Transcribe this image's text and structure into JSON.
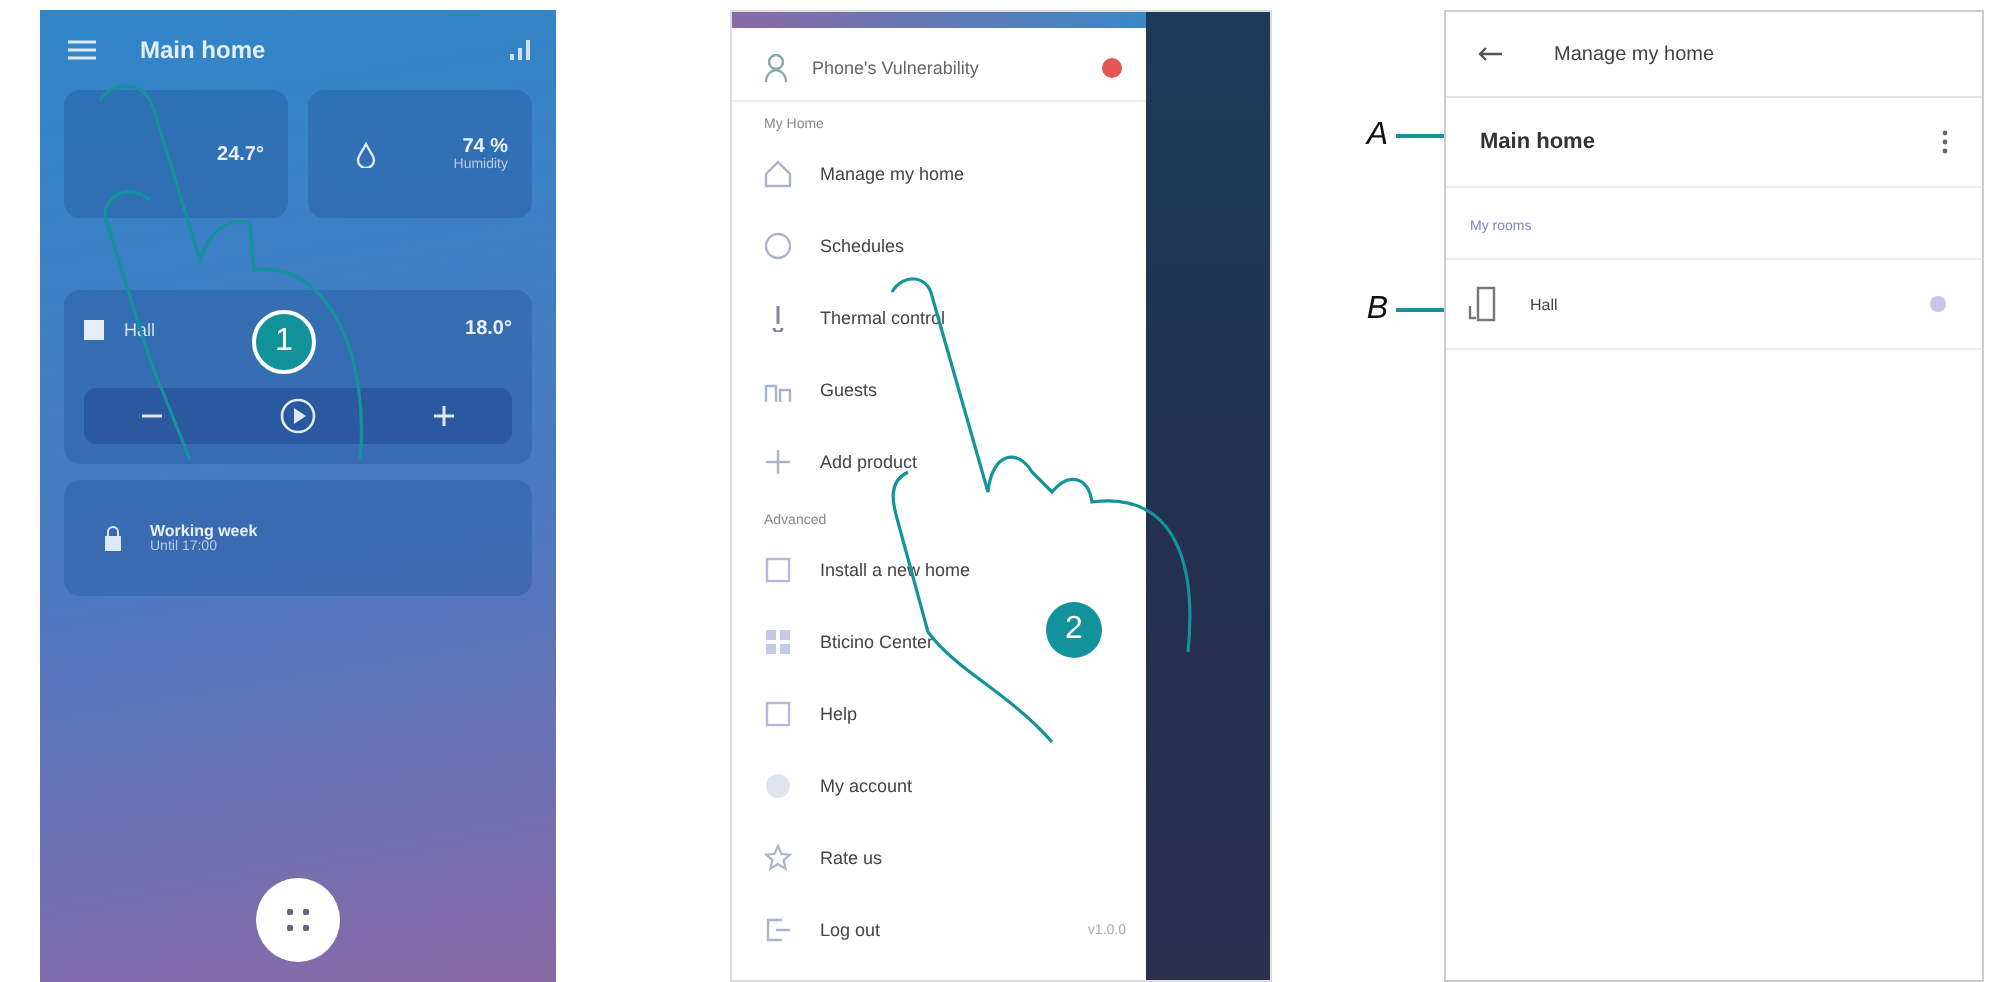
{
  "screens": [
    {
      "kind": "home",
      "title": "Main home",
      "temperature": "24.7°",
      "humidity": "74 %",
      "humidity_label": "Humidity",
      "room": {
        "name": "Hall",
        "reading": "18.0°"
      },
      "mode": {
        "title": "Working week",
        "subtitle": "Until 17:00"
      },
      "step": "1"
    },
    {
      "kind": "menu",
      "user": "Phone's Vulnerability",
      "sections": [
        {
          "title": "My Home",
          "items": [
            {
              "label": "Manage my home"
            },
            {
              "label": "Schedules"
            },
            {
              "label": "Thermal control"
            },
            {
              "label": "Guests"
            },
            {
              "label": "Add product"
            }
          ]
        },
        {
          "title": "Advanced",
          "items": [
            {
              "label": "Install a new home"
            },
            {
              "label": "Bticino Center"
            },
            {
              "label": "Help"
            },
            {
              "label": "My account"
            },
            {
              "label": "Rate us"
            },
            {
              "label": "Log out",
              "note": "v1.0.0"
            }
          ]
        }
      ],
      "step": "2"
    },
    {
      "kind": "manage",
      "title": "Manage my home",
      "home": "Main home",
      "section": "My rooms",
      "rooms": [
        "Hall"
      ],
      "callouts": [
        "A",
        "B"
      ]
    }
  ]
}
